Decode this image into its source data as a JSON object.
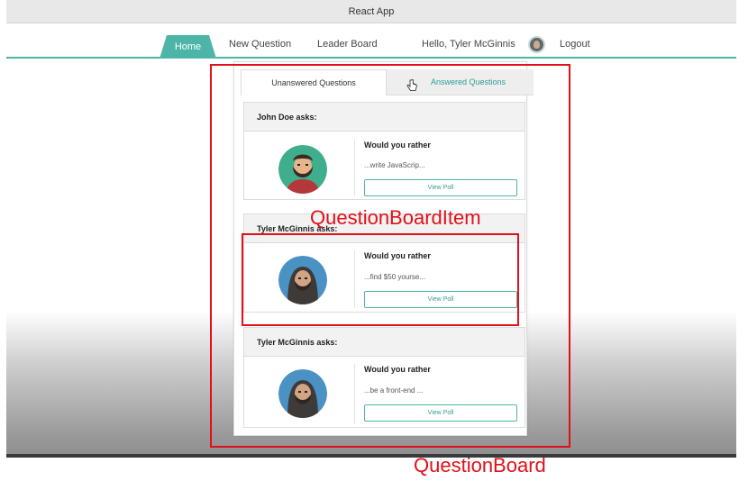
{
  "window": {
    "title": "React App"
  },
  "nav": {
    "items": [
      {
        "label": "Home"
      },
      {
        "label": "New Question"
      },
      {
        "label": "Leader Board"
      }
    ],
    "greeting": "Hello, Tyler McGinnis",
    "logout": "Logout"
  },
  "board": {
    "tabs": [
      {
        "label": "Unanswered Questions",
        "active": true
      },
      {
        "label": "Answered Questions",
        "active": false
      }
    ],
    "questions": [
      {
        "author_line": "John Doe asks:",
        "title": "Would you rather",
        "snippet": "...write JavaScrip...",
        "button": "View Poll",
        "avatar": "bearded-man-avatar"
      },
      {
        "author_line": "Tyler McGinnis asks:",
        "title": "Would you rather",
        "snippet": "...find $50 yourse...",
        "button": "View Poll",
        "avatar": "hooded-man-avatar"
      },
      {
        "author_line": "Tyler McGinnis asks:",
        "title": "Would you rather",
        "snippet": "...be a front-end ...",
        "button": "View Poll",
        "avatar": "hooded-man-avatar"
      }
    ]
  },
  "annotations": {
    "item_label": "QuestionBoardItem",
    "board_label": "QuestionBoard",
    "color": "#e0101a"
  },
  "colors": {
    "accent": "#4cb5a8"
  }
}
